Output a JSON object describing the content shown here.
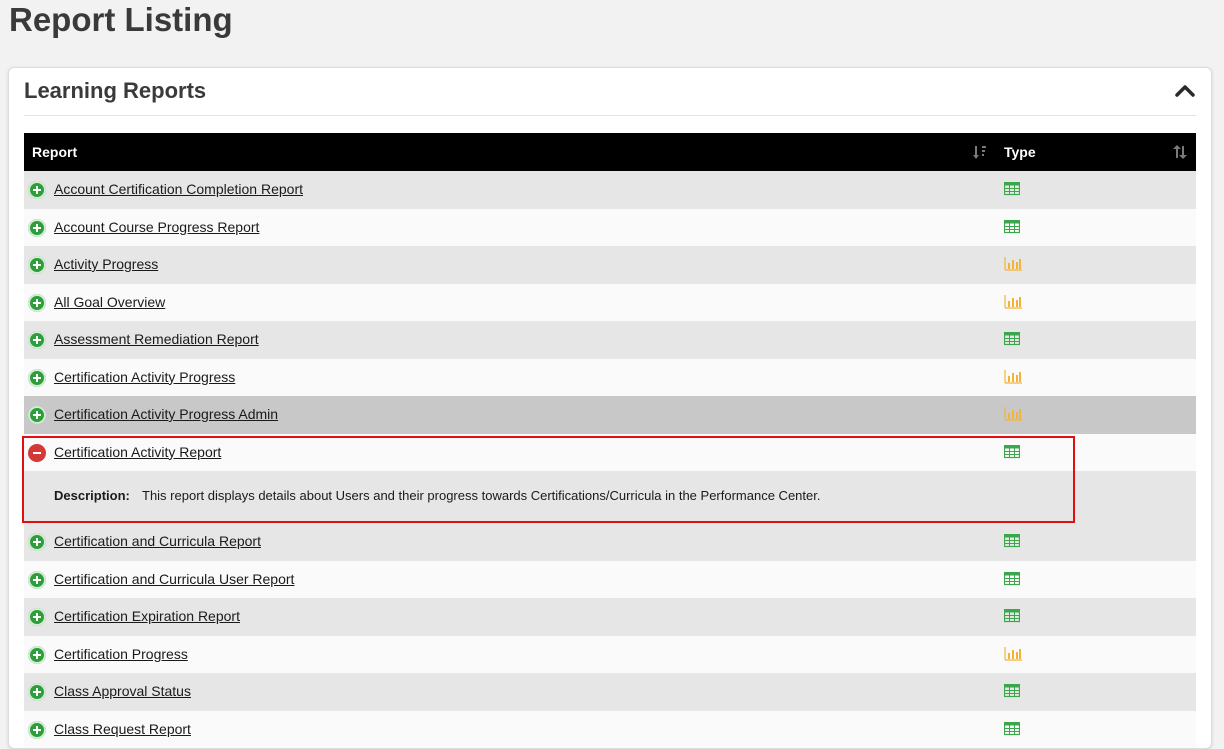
{
  "page": {
    "title": "Report Listing"
  },
  "panel": {
    "title": "Learning Reports",
    "collapse_icon": "chevron-up-icon"
  },
  "table": {
    "headers": {
      "report": "Report",
      "type": "Type"
    },
    "sort_icon": "sort-icon",
    "rows": [
      {
        "name": "Account Certification Completion Report",
        "type": "table",
        "expanded": false
      },
      {
        "name": "Account Course Progress Report",
        "type": "table",
        "expanded": false
      },
      {
        "name": "Activity Progress",
        "type": "chart",
        "expanded": false
      },
      {
        "name": "All Goal Overview",
        "type": "chart",
        "expanded": false
      },
      {
        "name": "Assessment Remediation Report",
        "type": "table",
        "expanded": false
      },
      {
        "name": "Certification Activity Progress",
        "type": "chart",
        "expanded": false
      },
      {
        "name": "Certification Activity Progress Admin",
        "type": "chart",
        "expanded": false,
        "hover": true
      },
      {
        "name": "Certification Activity Report",
        "type": "table",
        "expanded": true,
        "description_label": "Description:",
        "description": "This report displays details about Users and their progress towards Certifications/Curricula in the Performance Center."
      },
      {
        "name": "Certification and Curricula Report",
        "type": "table",
        "expanded": false
      },
      {
        "name": "Certification and Curricula User Report",
        "type": "table",
        "expanded": false
      },
      {
        "name": "Certification Expiration Report",
        "type": "table",
        "expanded": false
      },
      {
        "name": "Certification Progress",
        "type": "chart",
        "expanded": false
      },
      {
        "name": "Class Approval Status",
        "type": "table",
        "expanded": false
      },
      {
        "name": "Class Request Report",
        "type": "table",
        "expanded": false
      }
    ]
  },
  "colors": {
    "table_icon": "#3aa84a",
    "chart_icon": "#f5b335",
    "expand": "#2e9e3a",
    "collapse": "#d33a36",
    "highlight": "#e01010"
  }
}
